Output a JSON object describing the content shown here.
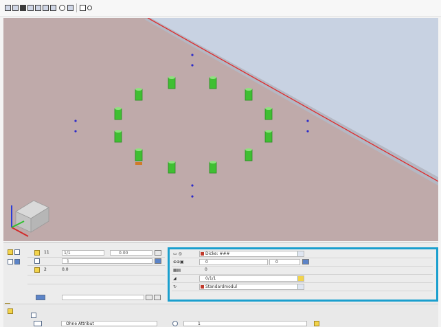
{
  "toolbar": {
    "buttons": [
      {
        "icon": "new-view-icon"
      },
      {
        "icon": "window-icon"
      },
      {
        "icon": "monitor-icon"
      },
      {
        "icon": "layers-icon"
      },
      {
        "icon": "copy-view-icon"
      },
      {
        "icon": "split-view-icon"
      },
      {
        "icon": "grid-icon"
      },
      {
        "icon": "zoom-icon"
      },
      {
        "icon": "zoom-window-icon"
      },
      {
        "icon": "pan-icon"
      },
      {
        "icon": "pointer-icon"
      }
    ]
  },
  "viewport": {
    "background_color": "#bfaaaa",
    "sky_color": "#c8d2e2",
    "object_color": "#3fbf32",
    "marker_color": "#2d2bc9",
    "edge_line_color": "#e02a2a"
  },
  "properties": {
    "left": {
      "rows": [
        {
          "num": "11",
          "value": "1/1",
          "value2": "0.00"
        },
        {
          "value": "1"
        },
        {
          "num": "2",
          "value": "0.0"
        }
      ]
    },
    "right": {
      "rows": [
        {
          "value": "Dicke: ###",
          "dropdown": true
        },
        {
          "value": "0",
          "value2": "0"
        },
        {
          "value": "0"
        },
        {
          "value": "0/1/1"
        },
        {
          "value": "Standardmodul",
          "dropdown": true
        }
      ]
    },
    "bottom": {
      "field": "Ohne Attribut",
      "field2": "1"
    }
  },
  "highlight_color": "#1a9fce"
}
